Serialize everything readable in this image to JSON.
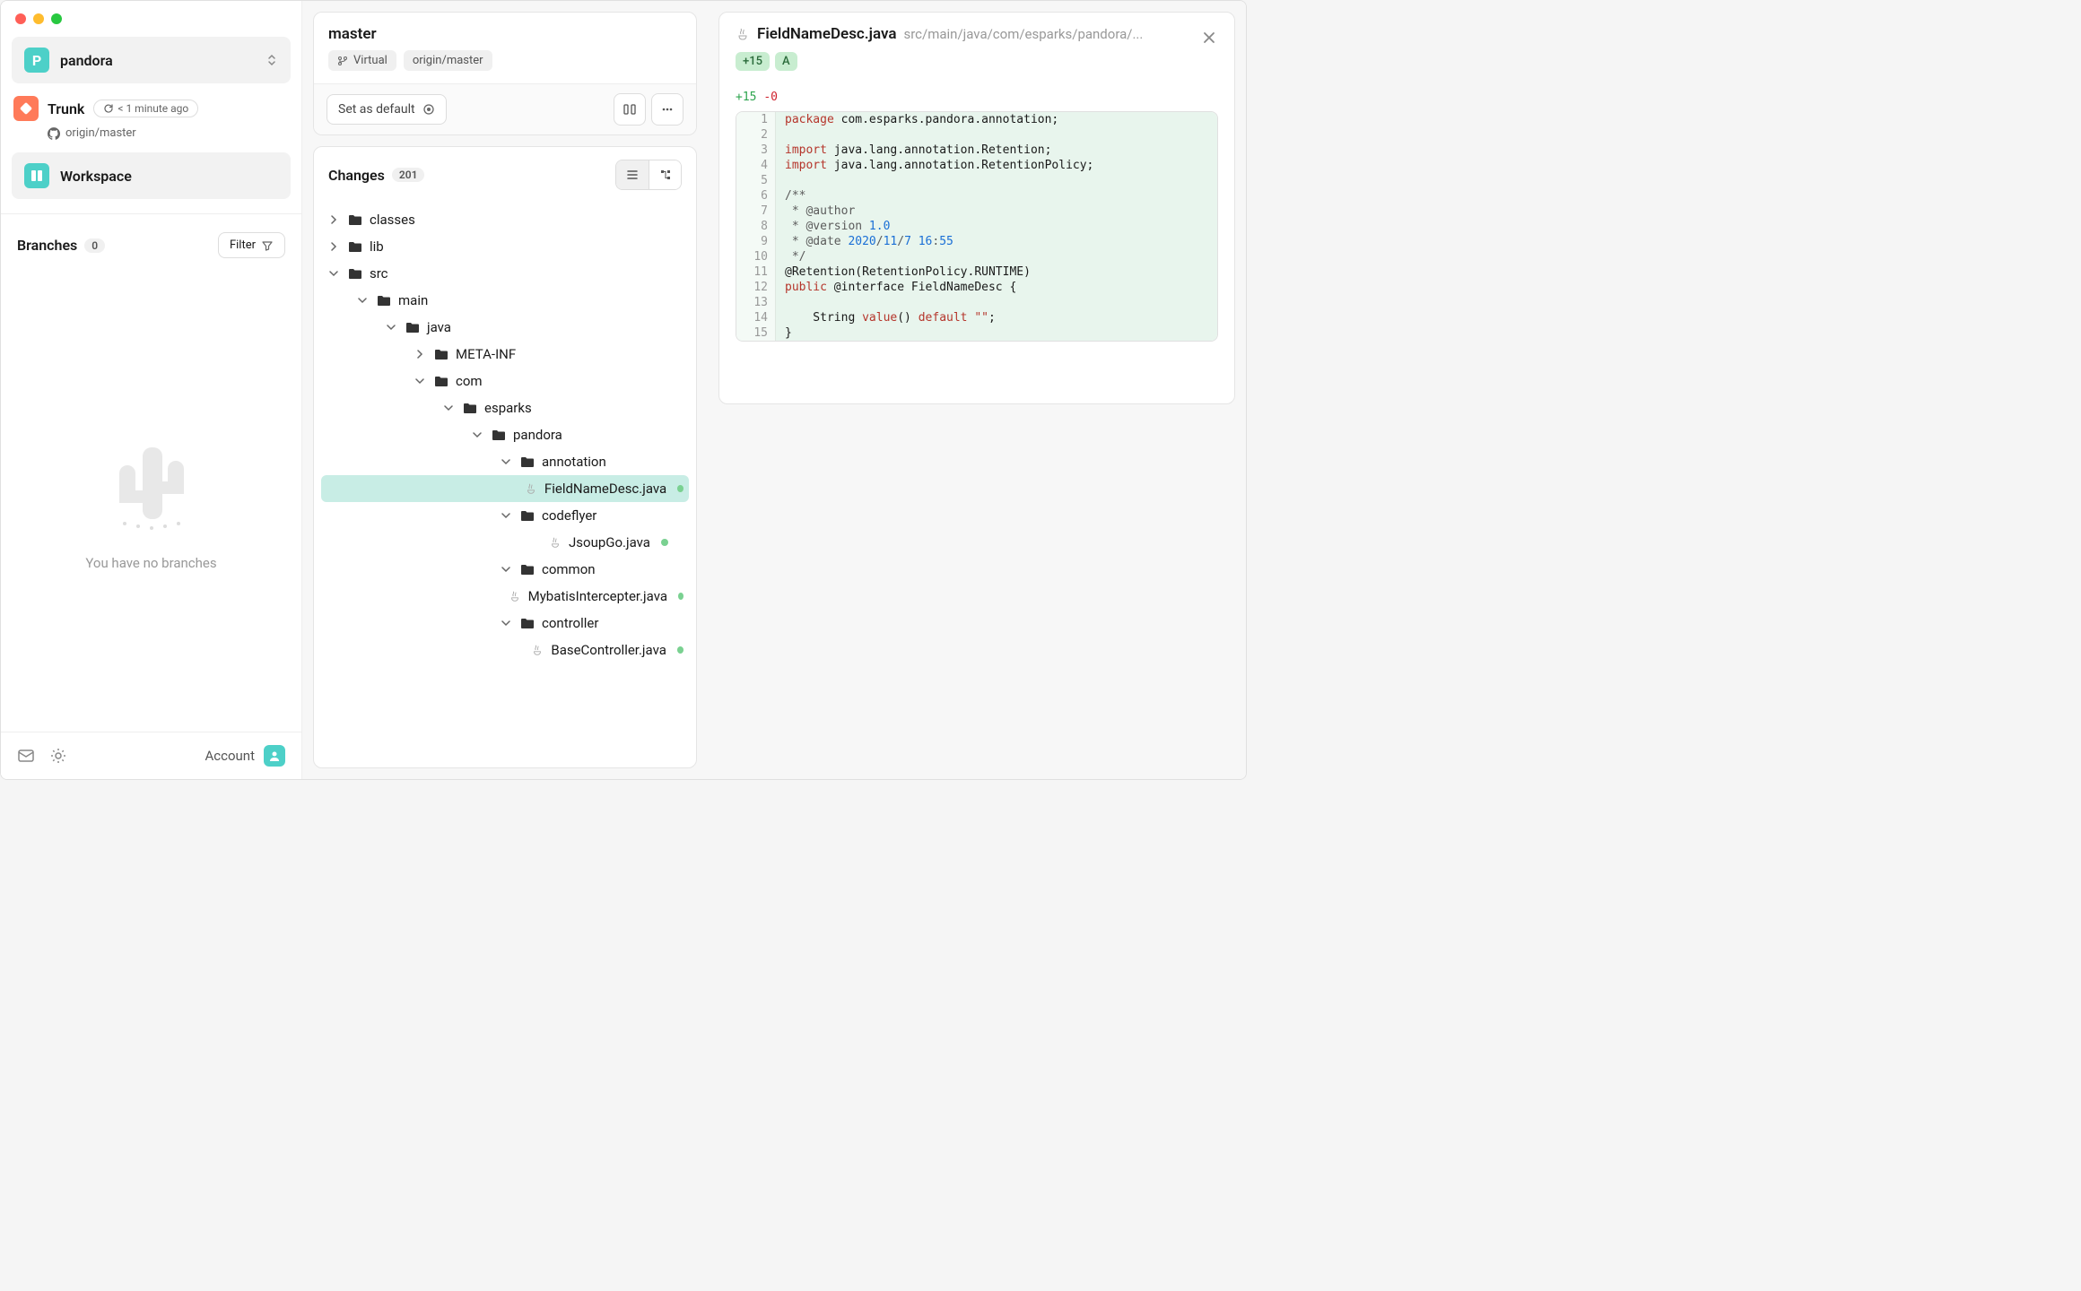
{
  "sidebar": {
    "repo": {
      "initial": "P",
      "name": "pandora"
    },
    "trunk": {
      "label": "Trunk",
      "badge": "< 1 minute ago",
      "remote": "origin/master"
    },
    "workspace": {
      "label": "Workspace"
    },
    "branches": {
      "title": "Branches",
      "count": "0",
      "filter_label": "Filter"
    },
    "empty": "You have no branches",
    "footer": {
      "account": "Account"
    }
  },
  "branch_card": {
    "name": "master",
    "virtual": "Virtual",
    "remote": "origin/master",
    "default_btn": "Set as default"
  },
  "changes": {
    "title": "Changes",
    "count": "201",
    "tree": [
      {
        "type": "folder",
        "name": "classes",
        "depth": 0,
        "expanded": false
      },
      {
        "type": "folder",
        "name": "lib",
        "depth": 0,
        "expanded": false
      },
      {
        "type": "folder",
        "name": "src",
        "depth": 0,
        "expanded": true
      },
      {
        "type": "folder",
        "name": "main",
        "depth": 1,
        "expanded": true
      },
      {
        "type": "folder",
        "name": "java",
        "depth": 2,
        "expanded": true
      },
      {
        "type": "folder",
        "name": "META-INF",
        "depth": 3,
        "expanded": false
      },
      {
        "type": "folder",
        "name": "com",
        "depth": 3,
        "expanded": true
      },
      {
        "type": "folder",
        "name": "esparks",
        "depth": 4,
        "expanded": true
      },
      {
        "type": "folder",
        "name": "pandora",
        "depth": 5,
        "expanded": true
      },
      {
        "type": "folder",
        "name": "annotation",
        "depth": 6,
        "expanded": true
      },
      {
        "type": "file",
        "name": "FieldNameDesc.java",
        "depth": 7,
        "selected": true,
        "modified": true
      },
      {
        "type": "folder",
        "name": "codeflyer",
        "depth": 6,
        "expanded": true
      },
      {
        "type": "file",
        "name": "JsoupGo.java",
        "depth": 7,
        "modified": true
      },
      {
        "type": "folder",
        "name": "common",
        "depth": 6,
        "expanded": true
      },
      {
        "type": "file",
        "name": "MybatisIntercepter.java",
        "depth": 7,
        "modified": true
      },
      {
        "type": "folder",
        "name": "controller",
        "depth": 6,
        "expanded": true
      },
      {
        "type": "file",
        "name": "BaseController.java",
        "depth": 7,
        "modified": true
      }
    ]
  },
  "diff": {
    "filename": "FieldNameDesc.java",
    "path": "src/main/java/com/esparks/pandora/...",
    "badge_add": "+15",
    "badge_letter": "A",
    "stats_plus": "+15",
    "stats_minus": "-0",
    "lines": [
      {
        "n": 1,
        "html": "<span class='tok-kw'>package</span> com.esparks.pandora.annotation;"
      },
      {
        "n": 2,
        "html": ""
      },
      {
        "n": 3,
        "html": "<span class='tok-kw'>import</span> java.lang.annotation.Retention;"
      },
      {
        "n": 4,
        "html": "<span class='tok-kw'>import</span> java.lang.annotation.RetentionPolicy;"
      },
      {
        "n": 5,
        "html": ""
      },
      {
        "n": 6,
        "html": "<span class='tok-cmt'>/**</span>"
      },
      {
        "n": 7,
        "html": "<span class='tok-cmt'> * @author</span>"
      },
      {
        "n": 8,
        "html": "<span class='tok-cmt'> * @version </span><span class='tok-num'>1.0</span>"
      },
      {
        "n": 9,
        "html": "<span class='tok-cmt'> * @date </span><span class='tok-num'>2020</span><span class='tok-cmt'>/</span><span class='tok-num'>11</span><span class='tok-cmt'>/</span><span class='tok-num'>7</span> <span class='tok-num'>16</span><span class='tok-cmt'>:</span><span class='tok-num'>55</span>"
      },
      {
        "n": 10,
        "html": "<span class='tok-cmt'> */</span>"
      },
      {
        "n": 11,
        "html": "@Retention(RetentionPolicy.RUNTIME)"
      },
      {
        "n": 12,
        "html": "<span class='tok-kw'>public</span> @interface FieldNameDesc {"
      },
      {
        "n": 13,
        "html": ""
      },
      {
        "n": 14,
        "html": "    String <span class='tok-kw'>value</span>() <span class='tok-kw'>default</span> <span class='tok-str'>\"\"</span>;"
      },
      {
        "n": 15,
        "html": "}"
      }
    ]
  }
}
